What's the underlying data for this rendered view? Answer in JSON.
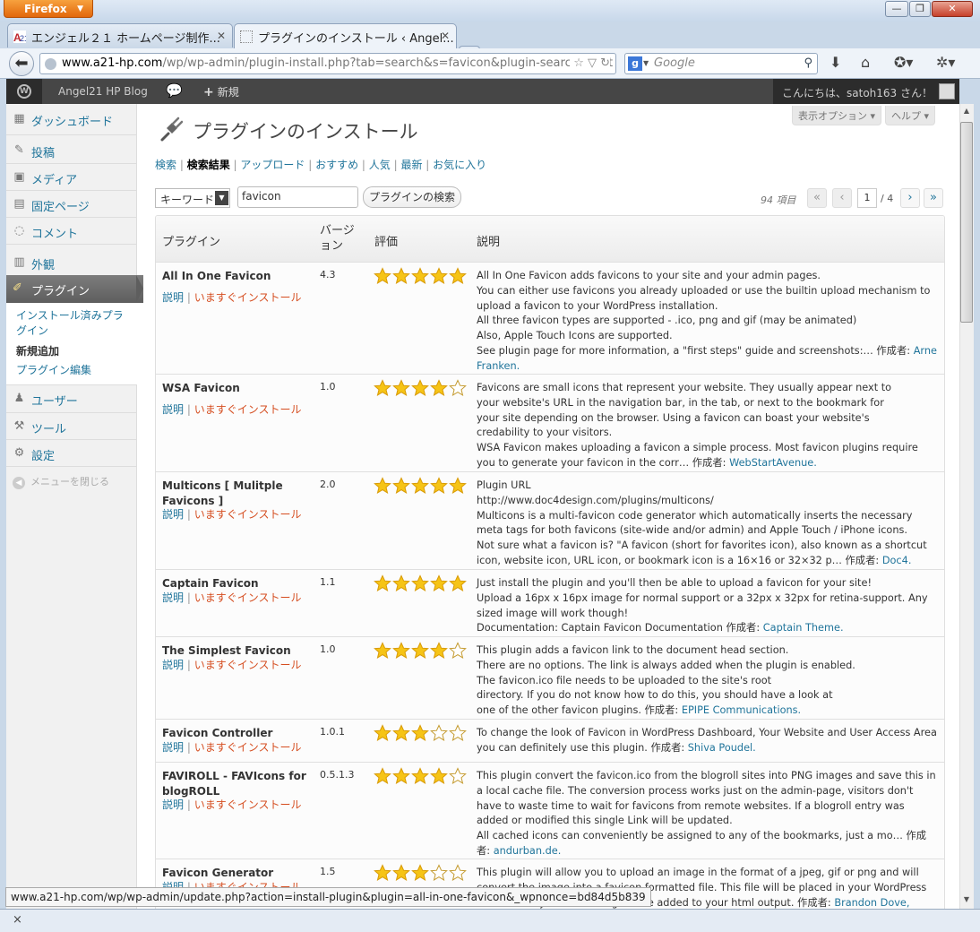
{
  "browser": {
    "app_button": "Firefox",
    "tabs": [
      {
        "label": "エンジェル２１ ホームページ制作..."
      },
      {
        "label": "プラグインのインストール ‹ Angel..."
      }
    ],
    "url_domain": "www.a21-hp.com",
    "url_path": "/wp/wp-admin/plugin-install.php?tab=search&s=favicon&plugin-search-input",
    "search_placeholder": "Google",
    "status_url": "www.a21-hp.com/wp/wp-admin/update.php?action=install-plugin&plugin=all-in-one-favicon&_wpnonce=bd84d5b839",
    "addon_close": "×"
  },
  "adminbar": {
    "site": "Angel21 HP Blog",
    "new_label": "新規",
    "greeting": "こんにちは、satoh163 さん！"
  },
  "menu": {
    "dashboard": "ダッシュボード",
    "posts": "投稿",
    "media": "メディア",
    "pages": "固定ページ",
    "comments": "コメント",
    "appearance": "外観",
    "plugins": "プラグイン",
    "sub_installed": "インストール済みプラグイン",
    "sub_add_new": "新規追加",
    "sub_editor": "プラグイン編集",
    "users": "ユーザー",
    "tools": "ツール",
    "settings": "設定",
    "collapse": "メニューを閉じる"
  },
  "header": {
    "screen_options": "表示オプション ▾",
    "help": "ヘルプ ▾",
    "title": "プラグインのインストール"
  },
  "subnav": {
    "search": "検索",
    "results": "検索結果",
    "upload": "アップロード",
    "featured": "おすすめ",
    "popular": "人気",
    "newest": "最新",
    "favorites": "お気に入り",
    "sep": " | "
  },
  "search": {
    "type": "キーワード",
    "term": "favicon",
    "button": "プラグインの検索"
  },
  "pagination": {
    "count": "94 項目",
    "first": "«",
    "prev": "‹",
    "current": "1",
    "total": "/ 4",
    "next": "›",
    "last": "»"
  },
  "table": {
    "headers": {
      "plugin": "プラグイン",
      "version": "バージョン",
      "rating": "評価",
      "description": "説明"
    },
    "details_label": "説明",
    "install_label": "いますぐインストール",
    "rows": [
      {
        "name": "All In One Favicon",
        "version": "4.3",
        "rating": 5,
        "desc": "All In One Favicon adds favicons to your site and your admin pages.\nYou can either use favicons you already uploaded or use the builtin upload mechanism to upload a favicon to your WordPress installation.\nAll three favicon types are supported - .ico, png and gif (may be animated)\nAlso, Apple Touch Icons are supported.\nSee plugin page for more information, a \"first steps\" guide and screenshots:… 作成者: ",
        "author": "Arne Franken."
      },
      {
        "name": "WSA Favicon",
        "version": "1.0",
        "rating": 4,
        "desc": "Favicons are small icons that represent your website. They usually appear next to\nyour website's URL in the navigation bar, in the tab, or next to the bookmark for\nyour site depending on the browser. Using a favicon can boast your website's\ncredability to your visitors.\nWSA Favicon makes uploading a favicon a simple process. Most favicon plugins require\nyou to generate your favicon in the corr… 作成者: ",
        "author": "WebStartAvenue."
      },
      {
        "name": "Multicons [ Mulitple Favicons ]",
        "version": "2.0",
        "rating": 5,
        "desc": "Plugin URL\nhttp://www.doc4design.com/plugins/multicons/\nMulticons is a multi-favicon code generator which automatically inserts the necessary meta tags for both favicons (site-wide and/or admin) and Apple Touch / iPhone icons.\nNot sure what a favicon is? \"A favicon (short for favorites icon), also known as a shortcut icon, website icon, URL icon, or bookmark icon is a 16×16 or 32×32 p… 作成者: ",
        "author": "Doc4."
      },
      {
        "name": "Captain Favicon",
        "version": "1.1",
        "rating": 5,
        "desc": "Just install the plugin and you'll then be able to upload a favicon for your site!\nUpload a 16px x 16px image for normal support or a 32px x 32px for retina-support. Any sized image will work though!\nDocumentation: Captain Favicon Documentation 作成者: ",
        "author": "Captain Theme."
      },
      {
        "name": "The Simplest Favicon",
        "version": "1.0",
        "rating": 4,
        "desc": "This plugin adds a favicon link to the document head section.\nThere are no options. The link is always added when the plugin is enabled.\nThe favicon.ico file needs to be uploaded to the site's root\ndirectory. If you do not know how to do this, you should have a look at\none of the other favicon plugins. 作成者: ",
        "author": "EPIPE Communications."
      },
      {
        "name": "Favicon Controller",
        "version": "1.0.1",
        "rating": 3,
        "desc": "To change the look of Favicon in WordPress Dashboard, Your Website and User Access Area you can definitely use this plugin. 作成者: ",
        "author": "Shiva Poudel."
      },
      {
        "name": "FAVIROLL - FAVIcons for blogROLL",
        "version": "0.5.1.3",
        "rating": 4,
        "desc": "This plugin convert the favicon.ico from the blogroll sites into PNG images and save this in a local cache file. The conversion process works just on the admin-page, visitors don't have to waste time to wait for favicons from remote websites. If a blogroll entry was added or modified this single Link will be updated.\nAll cached icons can conveniently be assigned to any of the bookmarks, just a mo… 作成者: ",
        "author": "andurban.de."
      },
      {
        "name": "Favicon Generator",
        "version": "1.5",
        "rating": 3,
        "desc": "This plugin will allow you to upload an image in the format of a jpeg, gif or png and will convert the image into a favicon formatted file. This file will be placed in your WordPress root directory and a link tag will be added to your html output. 作成者: ",
        "author": "Brandon Dove, Jeffrey Zinn."
      }
    ]
  }
}
